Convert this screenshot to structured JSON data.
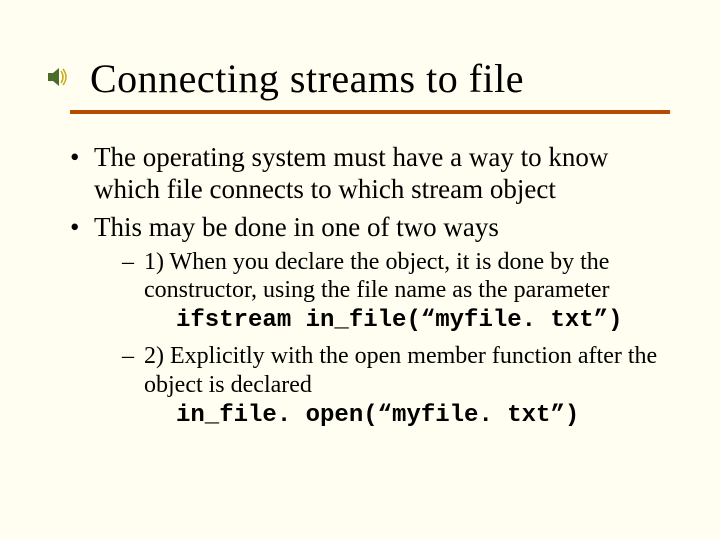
{
  "title": "Connecting streams to file",
  "bullets": {
    "b1": "The operating system must have a way to know which file connects to which stream object",
    "b2": "This may be done in one of two ways",
    "s1": "1) When you declare the object, it is done by the constructor, using the file name as the parameter",
    "c1": "ifstream in_file(“myfile. txt”)",
    "s2": "2) Explicitly with the open member function after the object is declared",
    "c2": "in_file. open(“myfile. txt”)"
  }
}
